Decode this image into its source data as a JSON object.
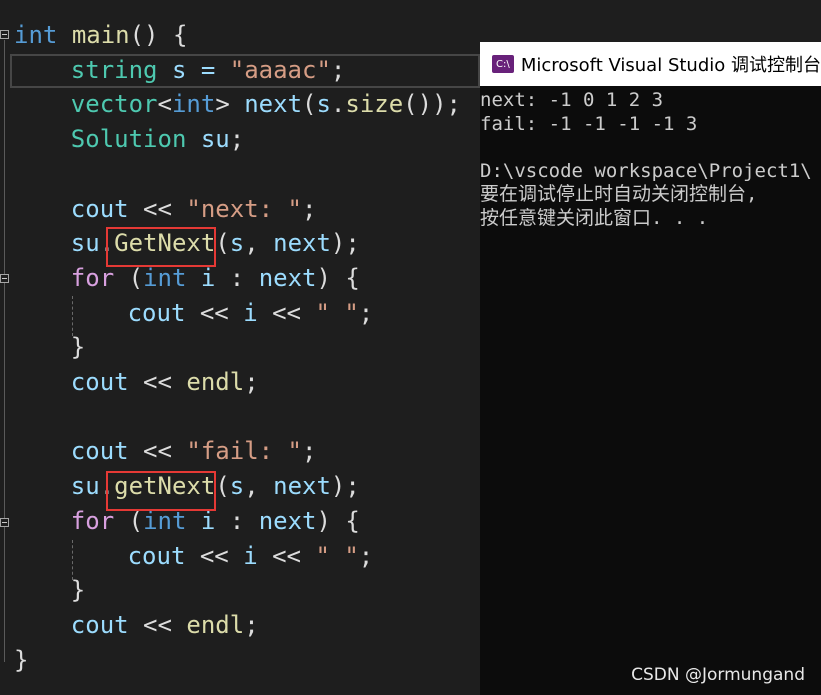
{
  "editor": {
    "lines": [
      [
        {
          "t": "int",
          "c": "tok-kw"
        },
        {
          "t": " ",
          "c": "tok-punc"
        },
        {
          "t": "main",
          "c": "tok-fn"
        },
        {
          "t": "() {",
          "c": "tok-punc"
        }
      ],
      [
        {
          "t": "string",
          "c": "tok-type"
        },
        {
          "t": " s = ",
          "c": "tok-var"
        },
        {
          "t": "\"aaaac\"",
          "c": "tok-str"
        },
        {
          "t": ";",
          "c": "tok-punc"
        }
      ],
      [
        {
          "t": "vector",
          "c": "tok-type"
        },
        {
          "t": "<",
          "c": "tok-punc"
        },
        {
          "t": "int",
          "c": "tok-kw"
        },
        {
          "t": "> ",
          "c": "tok-punc"
        },
        {
          "t": "next",
          "c": "tok-var"
        },
        {
          "t": "(",
          "c": "tok-punc"
        },
        {
          "t": "s",
          "c": "tok-var"
        },
        {
          "t": ".",
          "c": "tok-punc"
        },
        {
          "t": "size",
          "c": "tok-fn"
        },
        {
          "t": "());",
          "c": "tok-punc"
        }
      ],
      [
        {
          "t": "Solution",
          "c": "tok-type"
        },
        {
          "t": " ",
          "c": "tok-punc"
        },
        {
          "t": "su",
          "c": "tok-var"
        },
        {
          "t": ";",
          "c": "tok-punc"
        }
      ],
      [],
      [
        {
          "t": "cout",
          "c": "tok-var"
        },
        {
          "t": " << ",
          "c": "tok-punc"
        },
        {
          "t": "\"next: \"",
          "c": "tok-str"
        },
        {
          "t": ";",
          "c": "tok-punc"
        }
      ],
      [
        {
          "t": "su",
          "c": "tok-var"
        },
        {
          "t": ".",
          "c": "tok-punc"
        },
        {
          "t": "GetNext",
          "c": "tok-fn"
        },
        {
          "t": "(",
          "c": "tok-punc"
        },
        {
          "t": "s",
          "c": "tok-var"
        },
        {
          "t": ", ",
          "c": "tok-punc"
        },
        {
          "t": "next",
          "c": "tok-var"
        },
        {
          "t": ");",
          "c": "tok-punc"
        }
      ],
      [
        {
          "t": "for",
          "c": "tok-kw-ctrl"
        },
        {
          "t": " (",
          "c": "tok-punc"
        },
        {
          "t": "int",
          "c": "tok-kw"
        },
        {
          "t": " ",
          "c": "tok-punc"
        },
        {
          "t": "i",
          "c": "tok-var"
        },
        {
          "t": " : ",
          "c": "tok-punc"
        },
        {
          "t": "next",
          "c": "tok-var"
        },
        {
          "t": ") {",
          "c": "tok-punc"
        }
      ],
      [
        {
          "t": "cout",
          "c": "tok-var"
        },
        {
          "t": " << ",
          "c": "tok-punc"
        },
        {
          "t": "i",
          "c": "tok-var"
        },
        {
          "t": " << ",
          "c": "tok-punc"
        },
        {
          "t": "\" \"",
          "c": "tok-str"
        },
        {
          "t": ";",
          "c": "tok-punc"
        }
      ],
      [
        {
          "t": "}",
          "c": "tok-punc"
        }
      ],
      [
        {
          "t": "cout",
          "c": "tok-var"
        },
        {
          "t": " << ",
          "c": "tok-punc"
        },
        {
          "t": "endl",
          "c": "tok-fn"
        },
        {
          "t": ";",
          "c": "tok-punc"
        }
      ],
      [],
      [
        {
          "t": "cout",
          "c": "tok-var"
        },
        {
          "t": " << ",
          "c": "tok-punc"
        },
        {
          "t": "\"fail: \"",
          "c": "tok-str"
        },
        {
          "t": ";",
          "c": "tok-punc"
        }
      ],
      [
        {
          "t": "su",
          "c": "tok-var"
        },
        {
          "t": ".",
          "c": "tok-punc"
        },
        {
          "t": "getNext",
          "c": "tok-fn"
        },
        {
          "t": "(",
          "c": "tok-punc"
        },
        {
          "t": "s",
          "c": "tok-var"
        },
        {
          "t": ", ",
          "c": "tok-punc"
        },
        {
          "t": "next",
          "c": "tok-var"
        },
        {
          "t": ");",
          "c": "tok-punc"
        }
      ],
      [
        {
          "t": "for",
          "c": "tok-kw-ctrl"
        },
        {
          "t": " (",
          "c": "tok-punc"
        },
        {
          "t": "int",
          "c": "tok-kw"
        },
        {
          "t": " ",
          "c": "tok-punc"
        },
        {
          "t": "i",
          "c": "tok-var"
        },
        {
          "t": " : ",
          "c": "tok-punc"
        },
        {
          "t": "next",
          "c": "tok-var"
        },
        {
          "t": ") {",
          "c": "tok-punc"
        }
      ],
      [
        {
          "t": "cout",
          "c": "tok-var"
        },
        {
          "t": " << ",
          "c": "tok-punc"
        },
        {
          "t": "i",
          "c": "tok-var"
        },
        {
          "t": " << ",
          "c": "tok-punc"
        },
        {
          "t": "\" \"",
          "c": "tok-str"
        },
        {
          "t": ";",
          "c": "tok-punc"
        }
      ],
      [
        {
          "t": "}",
          "c": "tok-punc"
        }
      ],
      [
        {
          "t": "cout",
          "c": "tok-var"
        },
        {
          "t": " << ",
          "c": "tok-punc"
        },
        {
          "t": "endl",
          "c": "tok-fn"
        },
        {
          "t": ";",
          "c": "tok-punc"
        }
      ],
      [
        {
          "t": "}",
          "c": "tok-punc"
        }
      ]
    ]
  },
  "console": {
    "icon_text": "C:\\",
    "title": "Microsoft Visual Studio 调试控制台",
    "lines": [
      "next: -1 0 1 2 3",
      "fail: -1 -1 -1 -1 3",
      "",
      "D:\\vscode workspace\\Project1\\",
      "要在调试停止时自动关闭控制台,",
      "按任意键关闭此窗口. . ."
    ]
  },
  "watermark": "CSDN @Jormungand"
}
